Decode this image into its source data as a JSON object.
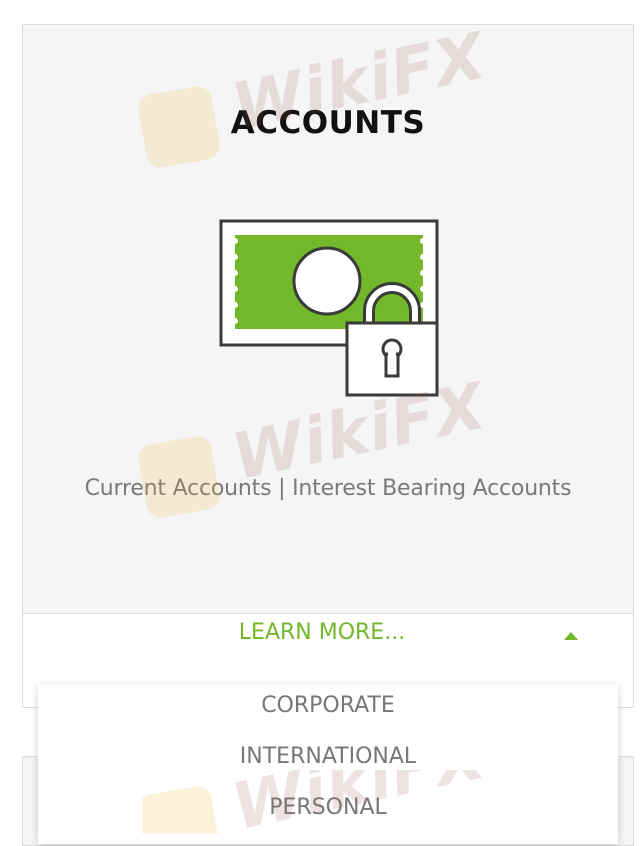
{
  "card": {
    "title": "ACCOUNTS",
    "subtitle": "Current Accounts | Interest Bearing Accounts",
    "learn_more_label": "LEARN MORE...",
    "illustration_icon": "cash-padlock-icon",
    "toggle_icon": "caret-up-icon"
  },
  "dropdown": {
    "items": [
      {
        "label": "CORPORATE"
      },
      {
        "label": "INTERNATIONAL"
      },
      {
        "label": "PERSONAL"
      }
    ]
  },
  "watermark": {
    "text": "WikiFX"
  },
  "colors": {
    "accent": "#73b72a",
    "card_bg": "#f5f5f5",
    "title": "#111111",
    "subtitle": "#7a7a7a",
    "menu_text": "#777777"
  }
}
